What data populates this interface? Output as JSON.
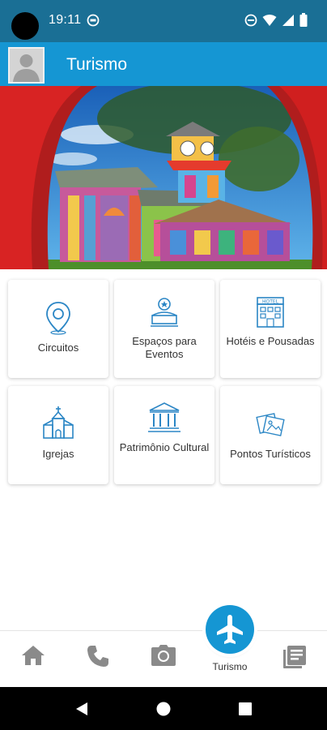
{
  "status_bar": {
    "time": "19:11",
    "left_icons": [
      "whatsapp-like-icon"
    ],
    "right_icons": [
      "do-not-disturb-icon",
      "wifi-icon",
      "signal-icon",
      "battery-icon"
    ]
  },
  "app_bar": {
    "title": "Turismo",
    "avatar_icon": "user-avatar-icon",
    "color": "#1596d3"
  },
  "hero": {
    "description_icon": "hero-image"
  },
  "categories": [
    {
      "label": "Circuitos",
      "icon": "map-pin-icon"
    },
    {
      "label": "Espaços para Eventos",
      "icon": "event-space-icon"
    },
    {
      "label": "Hotéis e Pousadas",
      "icon": "hotel-icon"
    },
    {
      "label": "Igrejas",
      "icon": "church-icon"
    },
    {
      "label": "Patrimônio Cultural",
      "icon": "heritage-building-icon"
    },
    {
      "label": "Pontos Turísticos",
      "icon": "photos-icon"
    }
  ],
  "bottom_nav": {
    "items": [
      {
        "icon": "home-icon"
      },
      {
        "icon": "phone-icon"
      },
      {
        "icon": "camera-icon"
      },
      {
        "icon": "airplane-icon",
        "label": "Turismo",
        "active": true
      },
      {
        "icon": "news-icon"
      }
    ]
  },
  "system_nav": {
    "items": [
      "back-icon",
      "home-circle-icon",
      "recents-icon"
    ]
  },
  "colors": {
    "status_bar": "#1a6f95",
    "accent": "#1596d3",
    "icon_blue": "#2b86c5",
    "nav_icon": "#8a8a8a"
  }
}
